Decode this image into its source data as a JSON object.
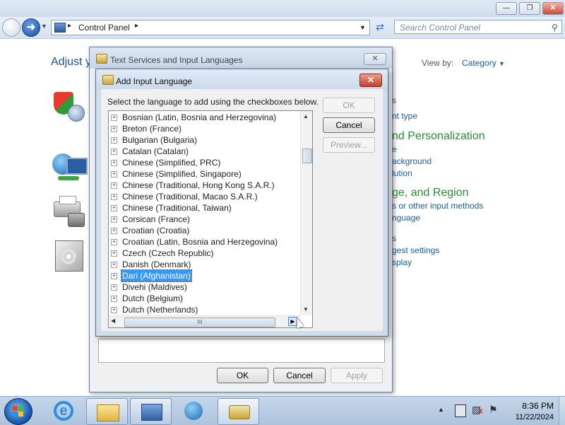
{
  "control_panel": {
    "breadcrumb_root": "Control Panel",
    "search_placeholder": "Search Control Panel",
    "heading_partial": "Adjust y",
    "view_by_label": "View by:",
    "view_by_value": "Category",
    "right_items": [
      {
        "text": "s",
        "kind": "link"
      },
      {
        "text": "nt type",
        "kind": "link"
      },
      {
        "text": "nd Personalization",
        "kind": "heading"
      },
      {
        "text": "e",
        "kind": "link"
      },
      {
        "text": "ackground",
        "kind": "link"
      },
      {
        "text": "lution",
        "kind": "link"
      },
      {
        "text": "ge, and Region",
        "kind": "heading"
      },
      {
        "text": "s or other input methods",
        "kind": "link"
      },
      {
        "text": "nguage",
        "kind": "link"
      },
      {
        "text": "s",
        "kind": "link"
      },
      {
        "text": "gest settings",
        "kind": "link"
      },
      {
        "text": "splay",
        "kind": "link"
      }
    ]
  },
  "text_services_dialog": {
    "title": "Text Services and Input Languages",
    "ok_label": "OK",
    "cancel_label": "Cancel",
    "apply_label": "Apply"
  },
  "add_language_dialog": {
    "title": "Add Input Language",
    "instruction": "Select the language to add using the checkboxes below.",
    "ok_label": "OK",
    "cancel_label": "Cancel",
    "preview_label": "Preview...",
    "expander_glyph": "+",
    "hscroll_grip": "III",
    "languages": [
      "Bosnian (Latin, Bosnia and Herzegovina)",
      "Breton (France)",
      "Bulgarian (Bulgaria)",
      "Catalan (Catalan)",
      "Chinese (Simplified, PRC)",
      "Chinese (Simplified, Singapore)",
      "Chinese (Traditional, Hong Kong S.A.R.)",
      "Chinese (Traditional, Macao S.A.R.)",
      "Chinese (Traditional, Taiwan)",
      "Corsican (France)",
      "Croatian (Croatia)",
      "Croatian (Latin, Bosnia and Herzegovina)",
      "Czech (Czech Republic)",
      "Danish (Denmark)",
      "Dari (Afghanistan)",
      "Divehi (Maldives)",
      "Dutch (Belgium)",
      "Dutch (Netherlands)"
    ],
    "selected_language": "Dari (Afghanistan)"
  },
  "taskbar": {
    "time": "8:36 PM",
    "date": "11/22/2024"
  },
  "colors": {
    "selection": "#3399ff",
    "link": "#1b5dab",
    "heading": "#2e8b3a"
  }
}
